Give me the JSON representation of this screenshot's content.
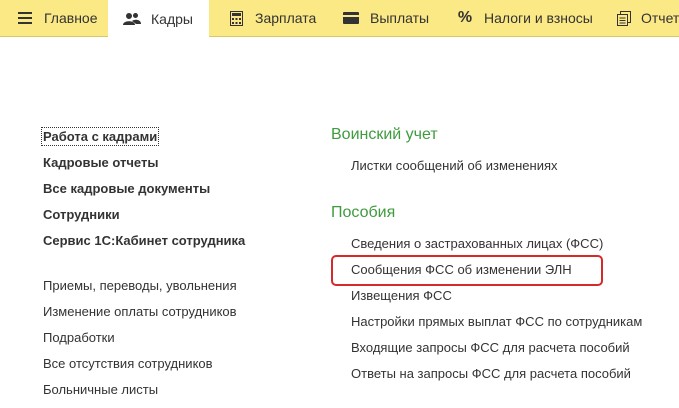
{
  "tabs": [
    {
      "label": "Главное",
      "icon": "hamburger-menu-icon"
    },
    {
      "label": "Кадры",
      "icon": "people-icon",
      "active": true
    },
    {
      "label": "Зарплата",
      "icon": "calculator-icon"
    },
    {
      "label": "Выплаты",
      "icon": "wallet-icon"
    },
    {
      "label": "Налоги и взносы",
      "icon": "percent-icon",
      "glyph": "%"
    },
    {
      "label": "Отчет",
      "icon": "reports-icon"
    }
  ],
  "left_column": {
    "primary": [
      "Работа с кадрами",
      "Кадровые отчеты",
      "Все кадровые документы",
      "Сотрудники",
      "Сервис 1С:Кабинет сотрудника"
    ],
    "secondary": [
      "Приемы, переводы, увольнения",
      "Изменение оплаты сотрудников",
      "Подработки",
      "Все отсутствия сотрудников",
      "Больничные листы"
    ]
  },
  "right_column": {
    "military": {
      "title": "Воинский учет",
      "items": [
        "Листки сообщений об изменениях"
      ]
    },
    "benefits": {
      "title": "Пособия",
      "items": [
        "Сведения о застрахованных лицах (ФСС)",
        "Сообщения ФСС об изменении ЭЛН",
        "Извещения ФСС",
        "Настройки прямых выплат ФСС по сотрудникам",
        "Входящие запросы ФСС для расчета пособий",
        "Ответы на запросы ФСС для расчета пособий"
      ]
    }
  },
  "colors": {
    "topbar": "#fbe985",
    "section_title": "#3f9b3f",
    "highlight_border": "#d42a2a"
  }
}
